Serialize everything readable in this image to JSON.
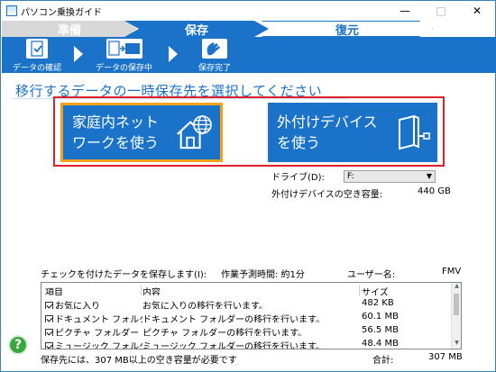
{
  "window": {
    "title": "パソコン乗換ガイド"
  },
  "steps": {
    "prep": "準備",
    "save": "保存",
    "restore": "復元"
  },
  "ribbon": {
    "items": [
      {
        "label": "データの確認",
        "icon": "document-check-icon"
      },
      {
        "label": "データの保存中",
        "icon": "copy-icon",
        "icon_text": "Copy"
      },
      {
        "label": "保存完了",
        "icon": "clap-icon"
      }
    ]
  },
  "heading": "移行するデータの一時保存先を選択してください",
  "choices": {
    "home": {
      "line1": "家庭内ネット",
      "line2": "ワークを使う",
      "icon": "home-network-icon"
    },
    "external": {
      "line1": "外付けデバイス",
      "line2": "を使う",
      "icon": "external-drive-icon"
    }
  },
  "drive": {
    "label": "ドライブ(D):",
    "value": "F:"
  },
  "free_space": {
    "label": "外付けデバイスの空き容量:",
    "value": "440 GB"
  },
  "info": {
    "checked_label": "チェックを付けたデータを保存します(I):",
    "eta_label": "作業予測時間: 約1分",
    "user_label": "ユーザー名:",
    "user_value": "FMV"
  },
  "table": {
    "columns": [
      "項目",
      "内容",
      "サイズ"
    ],
    "rows": [
      {
        "item": "お気に入り",
        "desc": "お気に入りの移行を行います。",
        "size": "482 KB"
      },
      {
        "item": "ドキュメント フォルダー",
        "desc": "ドキュメント フォルダーの移行を行います。",
        "size": "60.1 MB"
      },
      {
        "item": "ピクチャ フォルダー",
        "desc": "ピクチャ フォルダーの移行を行います。",
        "size": "56.5 MB"
      },
      {
        "item": "ミュージック フォルダー",
        "desc": "ミュージック フォルダーの移行を行います。",
        "size": "48.4 MB"
      }
    ]
  },
  "footer": {
    "requirement": "保存先には、307 MB以上の空き容量が必要です",
    "total_label": "合計:",
    "total_value": "307 MB"
  },
  "help": {
    "label": "?"
  },
  "colors": {
    "accent": "#1a73c8",
    "highlight_border": "#e0202a",
    "orange_focus": "#f5a21b"
  }
}
